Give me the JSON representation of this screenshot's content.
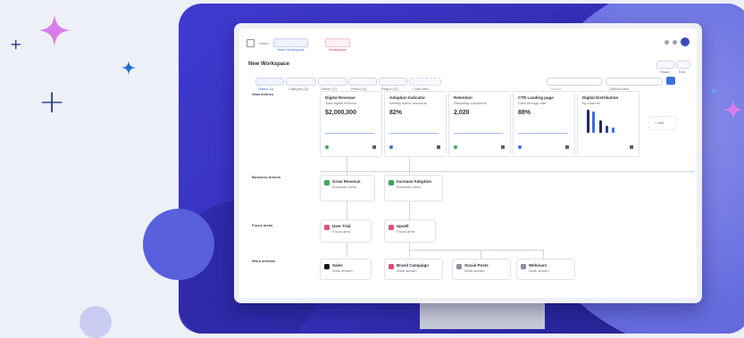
{
  "colors": {
    "background": "#eef0f8",
    "panel": "#3f3bd1",
    "circle": "#6b72e3",
    "accent_blue": "#3b6fe0",
    "accent_pink": "#e24e7a",
    "accent_green": "#3aa55a"
  },
  "icons": [
    "sparkle-pink-icon",
    "sparkle-blue-icon",
    "plus-icon",
    "grid-icon",
    "bell-icon",
    "avatar"
  ],
  "app": {
    "breadcrumb": [
      "Home",
      "Team Workspace",
      "Workspace"
    ],
    "title": "New Workspace",
    "top_buttons": [
      "Share",
      "Edit"
    ]
  },
  "filters": [
    "Status (3)",
    "Category (2)",
    "Owner (1)",
    "Period (4)",
    "Region (2)",
    "+ Add filter"
  ],
  "search_placeholder": "Search",
  "view_select": "Default view",
  "rows": [
    {
      "label": "Goal metrics",
      "count": "5"
    },
    {
      "label": "Business drivers",
      "count": "2"
    },
    {
      "label": "Focus areas",
      "count": "2"
    },
    {
      "label": "Work streams",
      "count": "4"
    }
  ],
  "metric_cards": [
    {
      "title": "Digital Revenue",
      "sub": "Total digital revenue",
      "value": "$2,000,000"
    },
    {
      "title": "Adoption Indicator",
      "sub": "Weekly active accounts",
      "value": "82%"
    },
    {
      "title": "Retention",
      "sub": "Returning customers",
      "value": "2,020"
    },
    {
      "title": "CTR Landing page",
      "sub": "Click through rate",
      "value": "88%"
    },
    {
      "title": "Digital Distribution",
      "sub": "By channel",
      "value": ""
    }
  ],
  "add_card": "+ Add",
  "driver_cards": [
    {
      "title": "Grow Revenue",
      "sub": "Business driver"
    },
    {
      "title": "Increase Adoption",
      "sub": "Business driver"
    }
  ],
  "focus_cards": [
    {
      "title": "User Trial",
      "sub": "Focus area"
    },
    {
      "title": "Upsell",
      "sub": "Focus area"
    }
  ],
  "stream_cards": [
    {
      "title": "Sales",
      "sub": "Work stream"
    },
    {
      "title": "Brand Campaign",
      "sub": "Work stream"
    },
    {
      "title": "Social Posts",
      "sub": "Work stream"
    },
    {
      "title": "Webinars",
      "sub": "Work stream"
    }
  ]
}
